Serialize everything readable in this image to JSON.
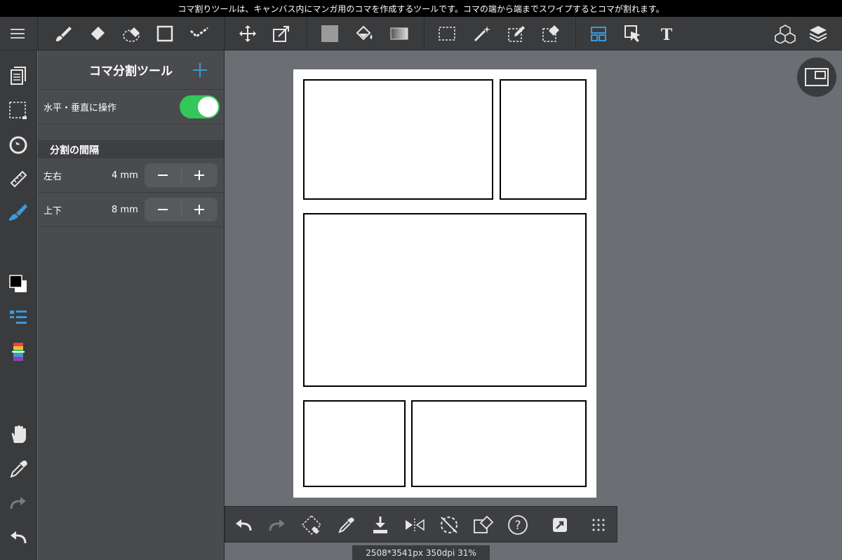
{
  "hint_text": "コマ割りツールは、キャンバス内にマンガ用のコマを作成するツールです。コマの端から端までスワイプするとコマが割れます。",
  "toolbar": {
    "items": [
      "menu-icon",
      "brush-icon",
      "eraser-icon",
      "blur-icon",
      "shape-icon",
      "dot-icon",
      "move-icon",
      "transform-icon",
      "fill-color-icon",
      "bucket-icon",
      "gradient-icon",
      "select-rect-icon",
      "magic-wand-icon",
      "select-pen-icon",
      "select-eraser-icon",
      "frame-divide-icon",
      "select-layer-icon",
      "text-icon",
      "3d-icon",
      "layers-icon"
    ]
  },
  "sidebar": {
    "items": [
      "page-icon",
      "selection-icon",
      "snap-icon",
      "ruler-icon",
      "brush-settings-icon",
      "color-icon",
      "brush-list-icon",
      "palette-icon",
      "hand-icon",
      "eyedropper-icon",
      "redo-icon",
      "undo-icon"
    ]
  },
  "panel": {
    "title": "コマ分割ツール",
    "toggle_label": "水平・垂直に操作",
    "toggle_on": true,
    "section_title": "分割の間隔",
    "rows": [
      {
        "label": "左右",
        "value": "4 mm"
      },
      {
        "label": "上下",
        "value": "8 mm"
      }
    ],
    "minus": "−",
    "plus": "+"
  },
  "canvas": {
    "frames": 5
  },
  "bottom_toolbar": {
    "items": [
      "undo-icon",
      "redo-icon",
      "transform-icon",
      "eyedropper-icon",
      "download-icon",
      "flip-icon",
      "rotate-icon",
      "clear-icon",
      "help-icon",
      "share-icon",
      "grid-icon"
    ],
    "help_label": "?"
  },
  "status": {
    "text": "2508*3541px 350dpi 31%"
  },
  "colors": {
    "accent": "#3a9ad9",
    "toggle": "#34c759"
  }
}
